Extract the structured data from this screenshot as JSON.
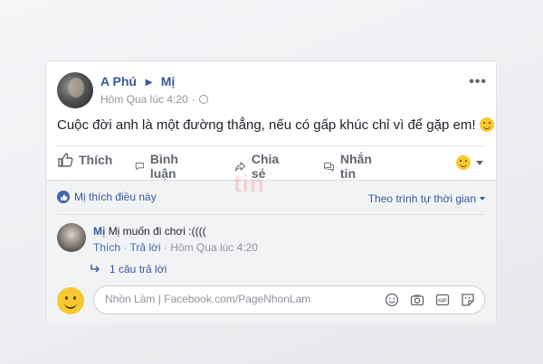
{
  "post": {
    "author": "A Phú",
    "recipient": "Mị",
    "time": "Hôm Qua lúc 4:20",
    "text": "Cuộc đời anh là một đường thẳng, nếu có gấp khúc chỉ vì để gặp em!"
  },
  "actions": {
    "like": "Thích",
    "comment": "Bình luận",
    "share": "Chia sẻ",
    "message": "Nhắn tin"
  },
  "reactions": {
    "liked_by": "Mị thích điều này",
    "sort": "Theo trình tự thời gian"
  },
  "comment": {
    "author": "Mị",
    "text": "Mị muốn đi chơi :((((",
    "like": "Thích",
    "reply": "Trả lời",
    "time": "Hôm Qua lúc 4:20",
    "replies": "1 câu trả lời"
  },
  "composer": {
    "placeholder": "Nhồn Lầm | Facebook.com/PageNhonLam"
  },
  "watermark": "tin",
  "icons": [
    "globe-icon",
    "more-icon",
    "like-icon",
    "comment-icon",
    "share-icon",
    "message-icon",
    "emoji-icon",
    "reply-arrow-icon",
    "camera-icon",
    "gif-icon",
    "sticker-icon"
  ]
}
